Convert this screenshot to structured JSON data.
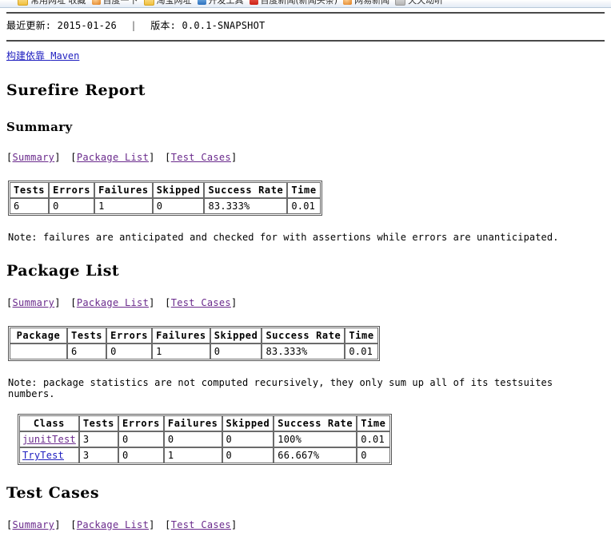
{
  "browser": {
    "bookmarks": [
      {
        "label": "常用网址 收藏",
        "icon": "folder-icon"
      },
      {
        "label": "百度一下",
        "icon": "orange-circle-icon"
      },
      {
        "label": "淘宝网址",
        "icon": "folder-icon"
      },
      {
        "label": "开发工具",
        "icon": "blue-square-icon"
      },
      {
        "label": "百度新闻(新闻头条)",
        "icon": "red-square-icon"
      },
      {
        "label": "网易新闻",
        "icon": "orange-square-icon"
      },
      {
        "label": "天天动听",
        "icon": "grey-square-icon"
      }
    ]
  },
  "header": {
    "last_published_label": "最近更新:",
    "last_published_value": "2015-01-26",
    "separator": "|",
    "version_label": "版本:",
    "version_value": "0.0.1-SNAPSHOT",
    "build_by_prefix": "构建依靠",
    "build_by_link": "Maven"
  },
  "page_title": "Surefire Report",
  "sections": {
    "summary": {
      "heading": "Summary",
      "nav": [
        "Summary",
        "Package List",
        "Test Cases"
      ],
      "note": "Note: failures are anticipated and checked for with assertions while errors are unanticipated.",
      "table": {
        "headers": [
          "Tests",
          "Errors",
          "Failures",
          "Skipped",
          "Success Rate",
          "Time"
        ],
        "rows": [
          [
            "6",
            "0",
            "1",
            "0",
            "83.333%",
            "0.01"
          ]
        ]
      }
    },
    "package_list": {
      "heading": "Package List",
      "nav": [
        "Summary",
        "Package List",
        "Test Cases"
      ],
      "note": "Note: package statistics are not computed recursively, they only sum up all of its testsuites numbers.",
      "table": {
        "headers": [
          "Package",
          "Tests",
          "Errors",
          "Failures",
          "Skipped",
          "Success Rate",
          "Time"
        ],
        "rows": [
          [
            "",
            "6",
            "0",
            "1",
            "0",
            "83.333%",
            "0.01"
          ]
        ]
      },
      "class_table": {
        "headers": [
          "Class",
          "Tests",
          "Errors",
          "Failures",
          "Skipped",
          "Success Rate",
          "Time"
        ],
        "rows": [
          {
            "class": "junitTest",
            "tests": "3",
            "errors": "0",
            "failures": "0",
            "skipped": "0",
            "rate": "100%",
            "time": "0.01"
          },
          {
            "class": "TryTest",
            "tests": "3",
            "errors": "0",
            "failures": "1",
            "skipped": "0",
            "rate": "66.667%",
            "time": "0"
          }
        ]
      }
    },
    "test_cases": {
      "heading": "Test Cases",
      "nav": [
        "Summary",
        "Package List",
        "Test Cases"
      ]
    }
  },
  "colors": {
    "link": "#2020c0",
    "visited_link": "#6a2a8c",
    "rule": "#4a4a4a",
    "table_border": "#6b6b6b"
  }
}
